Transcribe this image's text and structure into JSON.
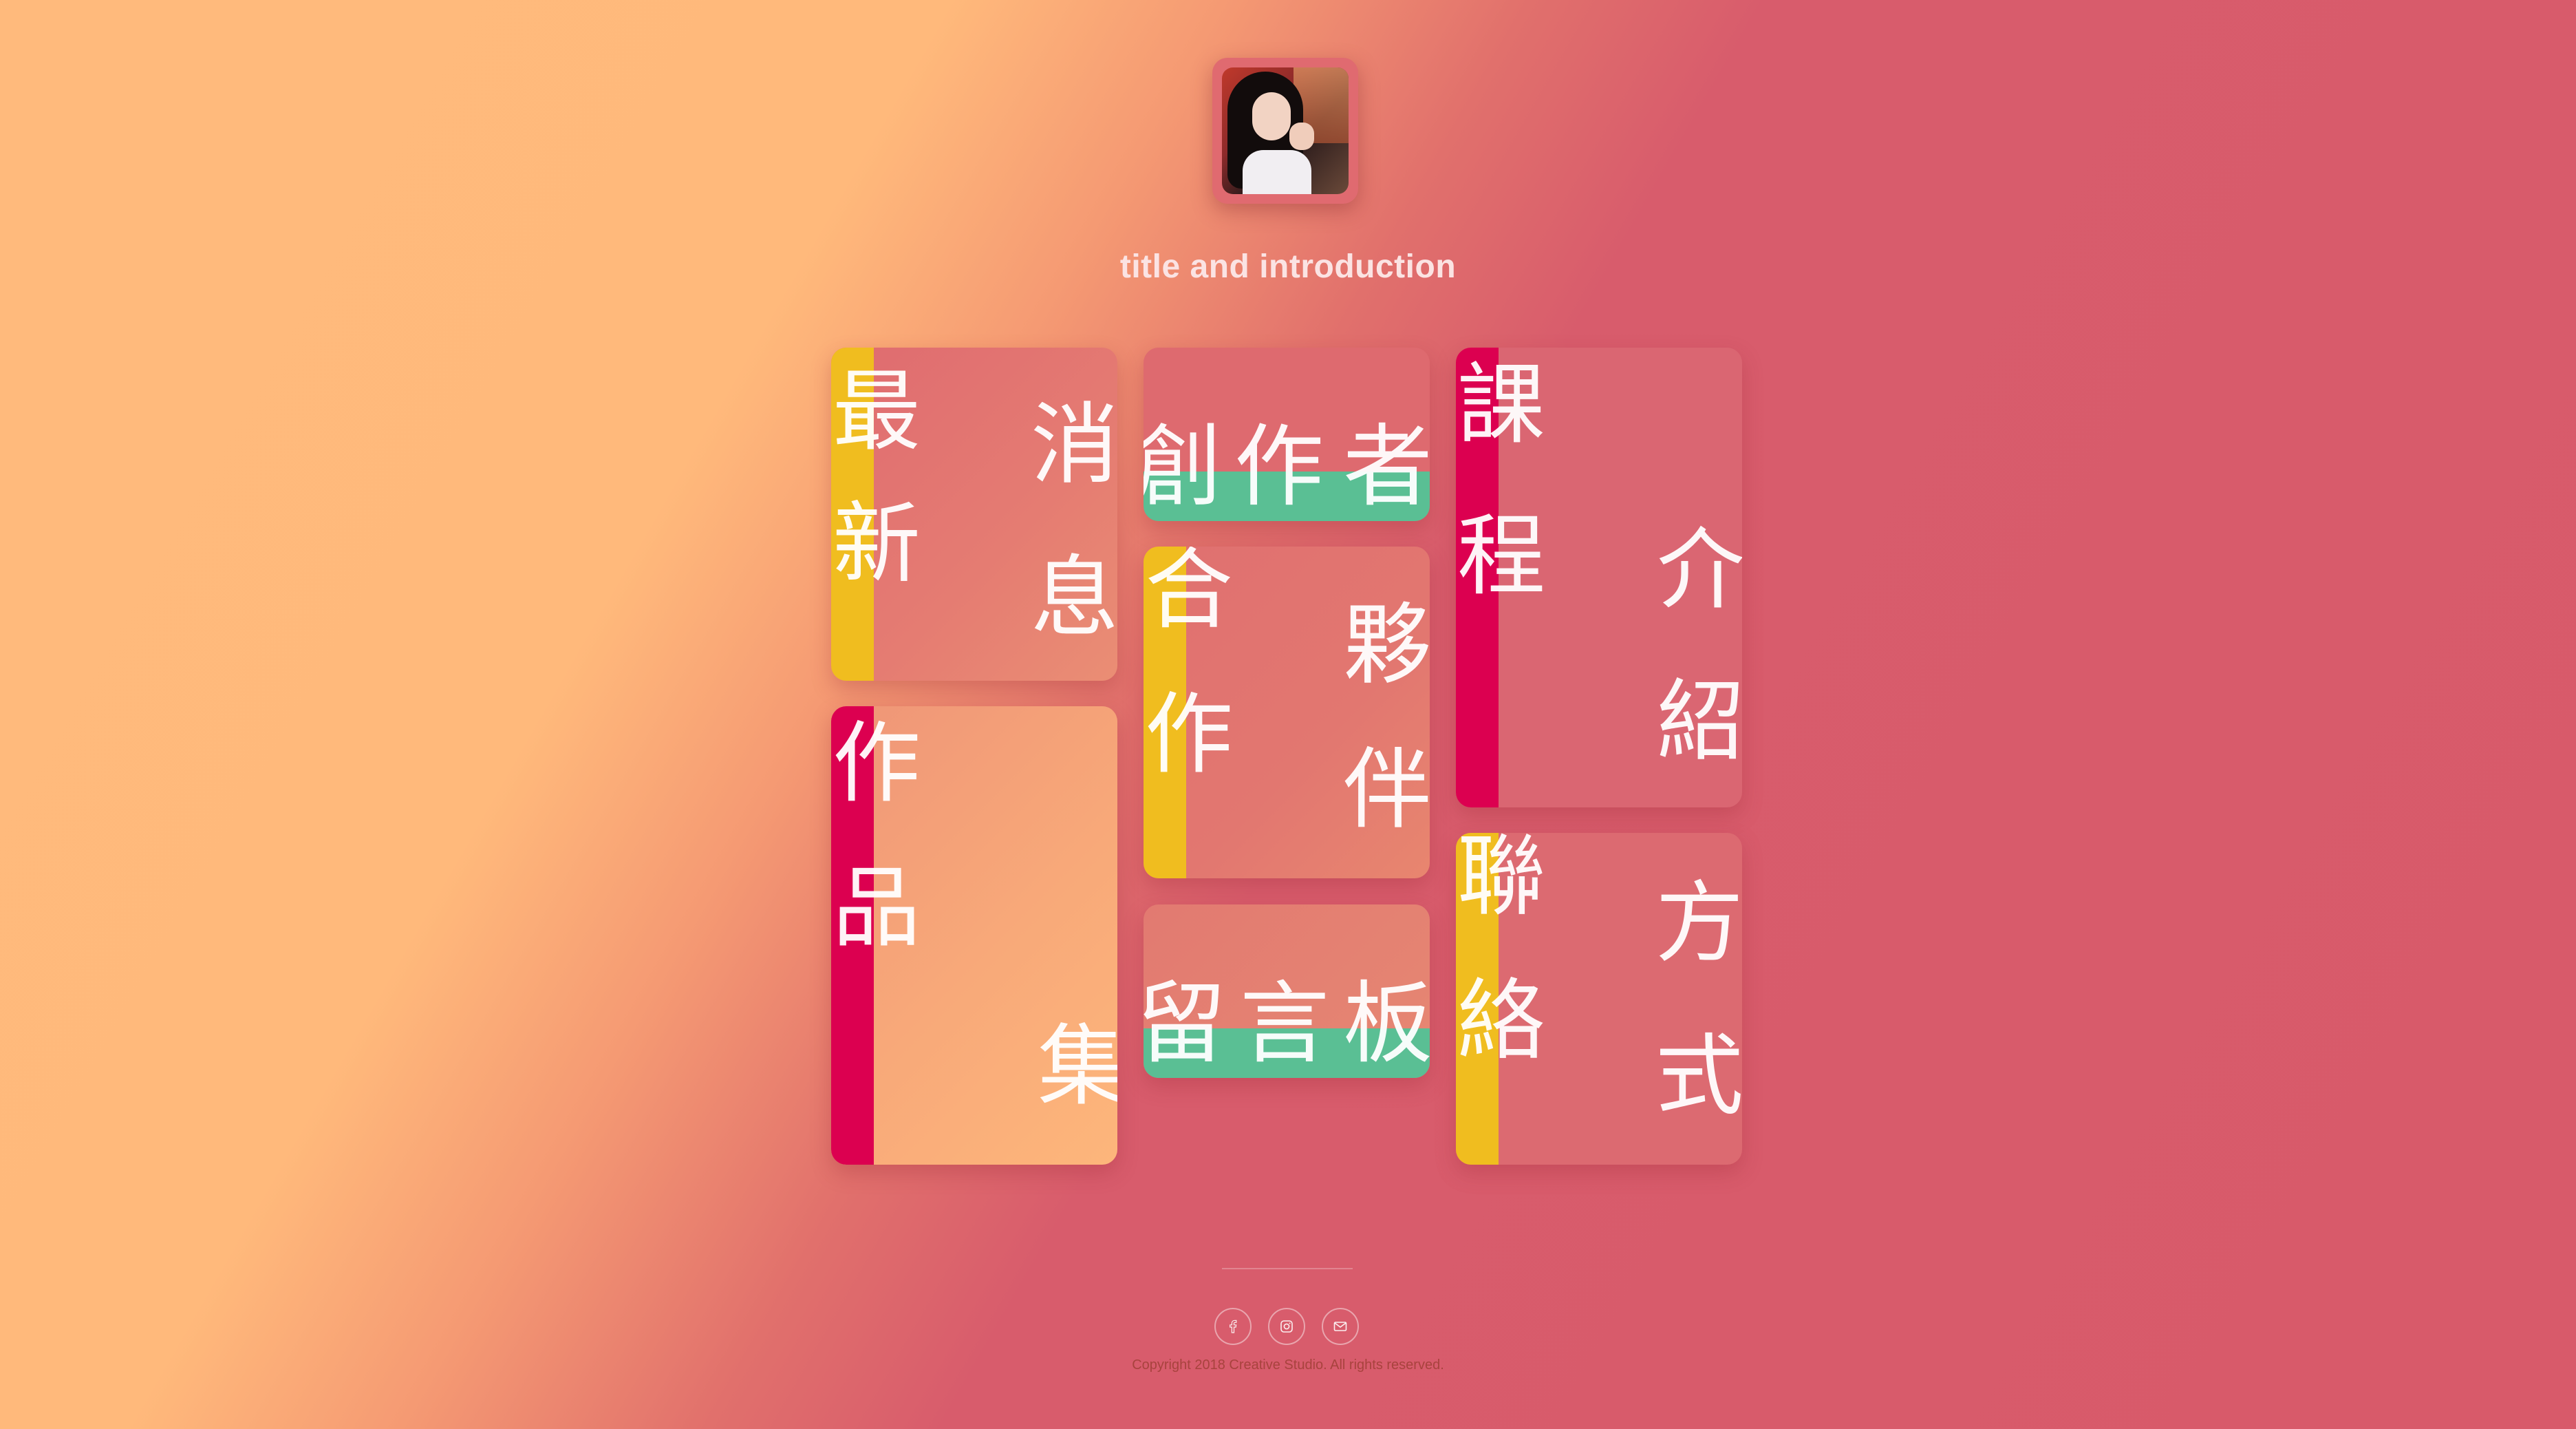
{
  "header": {
    "title": "title and introduction"
  },
  "cards": {
    "latest_news": {
      "c1": "最",
      "c2": "新",
      "c3": "消",
      "c4": "息"
    },
    "portfolio": {
      "c1": "作",
      "c2": "品",
      "c3": "集"
    },
    "creator": {
      "c1": "創",
      "c2": "作",
      "c3": "者"
    },
    "partners": {
      "c1": "合",
      "c2": "作",
      "c3": "夥",
      "c4": "伴"
    },
    "guestbook": {
      "c1": "留",
      "c2": "言",
      "c3": "板"
    },
    "courses": {
      "c1": "課",
      "c2": "程",
      "c3": "介",
      "c4": "紹"
    },
    "contact": {
      "c1": "聯",
      "c2": "絡",
      "c3": "方",
      "c4": "式"
    }
  },
  "footer": {
    "social_icons": [
      "facebook-icon",
      "instagram-icon",
      "mail-icon"
    ],
    "copyright": "Copyright 2018 Creative Studio. All rights reserved."
  },
  "colors": {
    "yellow_accent": "#f0bd1f",
    "magenta_accent": "#dc0050",
    "green_accent": "#5abf94"
  }
}
